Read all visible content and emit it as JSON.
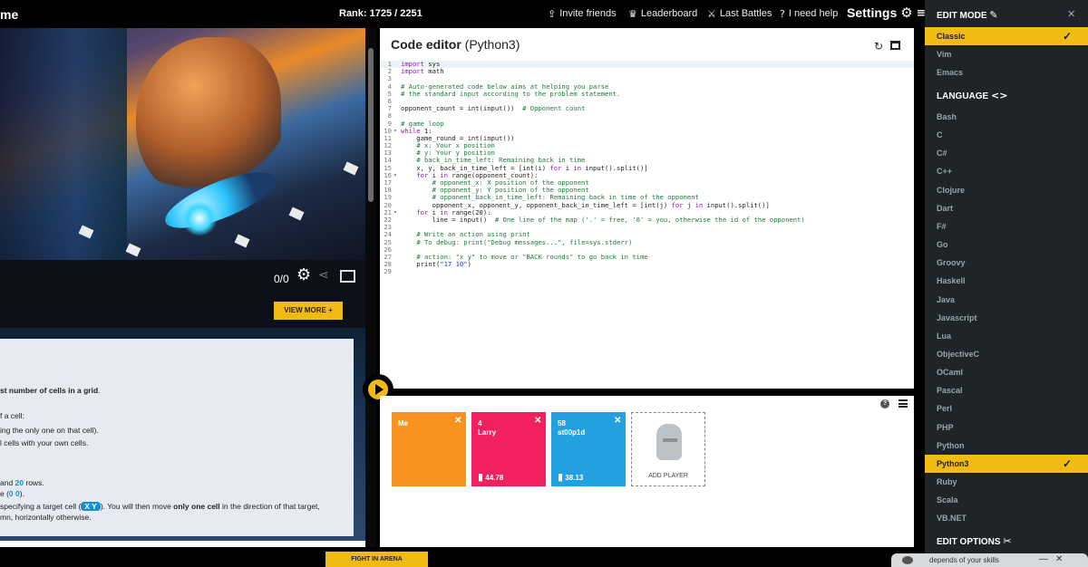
{
  "topbar": {
    "title_partial": "me",
    "rank": "Rank: 1725 / 2251",
    "nav": [
      {
        "icon": "share-icon",
        "label": "Invite friends"
      },
      {
        "icon": "trophy-icon",
        "label": "Leaderboard"
      },
      {
        "icon": "battle-icon",
        "label": "Last Battles"
      },
      {
        "icon": "question-icon",
        "label": "I need help"
      }
    ],
    "settings_label": "Settings"
  },
  "viewer": {
    "frame_counter": "0/0",
    "view_more": "VIEW MORE +"
  },
  "statement": {
    "lines": [
      {
        "html": "<b>st number of cells in a grid</b>."
      },
      {
        "html": "f a cell:"
      },
      {
        "html": "ing the only one on that cell)."
      },
      {
        "html": "l cells with your own cells."
      },
      {
        "html": "and <span class='hl'>20</span> rows."
      },
      {
        "html": "e (<span class='hl'>0 0</span>)."
      },
      {
        "html": "specifying a target cell (<span class='chip'>X Y</span>). You will then move <b>only one cell</b> in the direction of that target,"
      },
      {
        "html": "mn, horizontally otherwise."
      }
    ]
  },
  "editor": {
    "title": "Code editor",
    "language": "(Python3)",
    "lines": [
      {
        "n": "1",
        "fold": "",
        "html": "<span class='c-kw'>import</span> sys"
      },
      {
        "n": "2",
        "fold": "",
        "html": "<span class='c-kw'>import</span> math"
      },
      {
        "n": "3",
        "fold": "",
        "html": ""
      },
      {
        "n": "4",
        "fold": "",
        "html": "<span class='c-cm'># Auto-generated code below aims at helping you parse</span>"
      },
      {
        "n": "5",
        "fold": "",
        "html": "<span class='c-cm'># the standard input according to the problem statement.</span>"
      },
      {
        "n": "6",
        "fold": "",
        "html": ""
      },
      {
        "n": "7",
        "fold": "",
        "html": "opponent_count = int(input())  <span class='c-cm'># Opponent count</span>"
      },
      {
        "n": "8",
        "fold": "",
        "html": ""
      },
      {
        "n": "9",
        "fold": "",
        "html": "<span class='c-cm'># game loop</span>"
      },
      {
        "n": "10",
        "fold": "▾",
        "html": "<span class='c-kw'>while</span> 1:"
      },
      {
        "n": "11",
        "fold": "",
        "html": "    game_round = int(input())"
      },
      {
        "n": "12",
        "fold": "",
        "html": "    <span class='c-cm'># x: Your x position</span>"
      },
      {
        "n": "13",
        "fold": "",
        "html": "    <span class='c-cm'># y: Your y position</span>"
      },
      {
        "n": "14",
        "fold": "",
        "html": "    <span class='c-cm'># back_in_time_left: Remaining back in time</span>"
      },
      {
        "n": "15",
        "fold": "",
        "html": "    x, y, back_in_time_left = [int(i) <span class='c-kw'>for</span> i <span class='c-kw'>in</span> input().split()]"
      },
      {
        "n": "16",
        "fold": "▾",
        "html": "    <span class='c-kw'>for</span> i <span class='c-kw'>in</span> range(opponent_count):"
      },
      {
        "n": "17",
        "fold": "",
        "html": "        <span class='c-cm'># opponent_x: X position of the opponent</span>"
      },
      {
        "n": "18",
        "fold": "",
        "html": "        <span class='c-cm'># opponent_y: Y position of the opponent</span>"
      },
      {
        "n": "19",
        "fold": "",
        "html": "        <span class='c-cm'># opponent_back_in_time_left: Remaining back in time of the opponent</span>"
      },
      {
        "n": "20",
        "fold": "",
        "html": "        opponent_x, opponent_y, opponent_back_in_time_left = [int(j) <span class='c-kw'>for</span> j <span class='c-kw'>in</span> input().split()]"
      },
      {
        "n": "21",
        "fold": "▾",
        "html": "    <span class='c-kw'>for</span> i <span class='c-kw'>in</span> range(20):"
      },
      {
        "n": "22",
        "fold": "",
        "html": "        line = input()  <span class='c-cm'># One line of the map ('.' = free, '0' = you, otherwise the id of the opponent)</span>"
      },
      {
        "n": "23",
        "fold": "",
        "html": ""
      },
      {
        "n": "24",
        "fold": "",
        "html": "    <span class='c-cm'># Write an action using print</span>"
      },
      {
        "n": "25",
        "fold": "",
        "html": "    <span class='c-cm'># To debug: print(\"Debug messages...\", file=sys.stderr)</span>"
      },
      {
        "n": "26",
        "fold": "",
        "html": ""
      },
      {
        "n": "27",
        "fold": "",
        "html": "    <span class='c-cm'># action: \"x y\" to move or \"BACK rounds\" to go back in time</span>"
      },
      {
        "n": "28",
        "fold": "",
        "html": "    print(<span class='c-st'>\"17 10\"</span>)"
      },
      {
        "n": "29",
        "fold": "",
        "html": ""
      }
    ]
  },
  "players": {
    "cards": [
      {
        "name": "Me",
        "score": "",
        "color": "#f7931e"
      },
      {
        "name": "4\nLarry",
        "score": "44.78",
        "color": "#f2205f"
      },
      {
        "name": "58\nst00p1d",
        "score": "38.13",
        "color": "#22a0e0"
      }
    ],
    "add_label": "ADD PLAYER"
  },
  "fight_label": "FIGHT IN ARENA",
  "sidebar": {
    "edit_mode_title": "EDIT MODE",
    "edit_modes": [
      {
        "label": "Classic",
        "active": true
      },
      {
        "label": "Vim",
        "active": false
      },
      {
        "label": "Emacs",
        "active": false
      }
    ],
    "language_title": "LANGUAGE",
    "languages": [
      {
        "label": "Bash",
        "active": false
      },
      {
        "label": "C",
        "active": false
      },
      {
        "label": "C#",
        "active": false
      },
      {
        "label": "C++",
        "active": false
      },
      {
        "label": "Clojure",
        "active": false
      },
      {
        "label": "Dart",
        "active": false
      },
      {
        "label": "F#",
        "active": false
      },
      {
        "label": "Go",
        "active": false
      },
      {
        "label": "Groovy",
        "active": false
      },
      {
        "label": "Haskell",
        "active": false
      },
      {
        "label": "Java",
        "active": false
      },
      {
        "label": "Javascript",
        "active": false
      },
      {
        "label": "Lua",
        "active": false
      },
      {
        "label": "ObjectiveC",
        "active": false
      },
      {
        "label": "OCaml",
        "active": false
      },
      {
        "label": "Pascal",
        "active": false
      },
      {
        "label": "Perl",
        "active": false
      },
      {
        "label": "PHP",
        "active": false
      },
      {
        "label": "Python",
        "active": false
      },
      {
        "label": "Python3",
        "active": true
      },
      {
        "label": "Ruby",
        "active": false
      },
      {
        "label": "Scala",
        "active": false
      },
      {
        "label": "VB.NET",
        "active": false
      }
    ],
    "edit_options_title": "EDIT OPTIONS"
  },
  "chat": {
    "text": "depends of your skills"
  },
  "colors": {
    "accent": "#f2bb13",
    "sidebar": "#1e2428",
    "card_me": "#f7931e",
    "card_larry": "#f2205f",
    "card_st00p1d": "#22a0e0"
  }
}
